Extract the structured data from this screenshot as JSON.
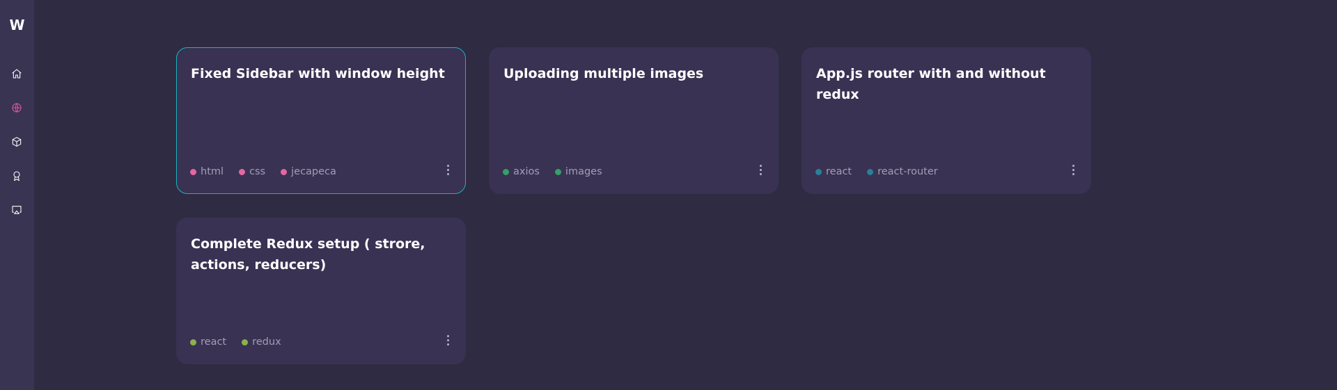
{
  "app": {
    "logo": "W"
  },
  "sidebar": {
    "icons": [
      "home-icon",
      "globe-icon",
      "cube-icon",
      "award-icon",
      "airplay-icon"
    ],
    "active": "globe-icon"
  },
  "colors": {
    "selected_border": "#1bb3be",
    "pink": "#e5679f",
    "green": "#35a067",
    "teal": "#2a7f9b",
    "olive": "#8bb24d"
  },
  "cards": [
    {
      "title": "Fixed Sidebar with window height",
      "selected": true,
      "tags": [
        {
          "label": "html",
          "color": "#e5679f"
        },
        {
          "label": "css",
          "color": "#e5679f"
        },
        {
          "label": "jecapeca",
          "color": "#e5679f"
        }
      ]
    },
    {
      "title": "Uploading multiple images",
      "selected": false,
      "tags": [
        {
          "label": "axios",
          "color": "#35a067"
        },
        {
          "label": "images",
          "color": "#35a067"
        }
      ]
    },
    {
      "title": "App.js router with and without redux",
      "selected": false,
      "tags": [
        {
          "label": "react",
          "color": "#2a7f9b"
        },
        {
          "label": "react-router",
          "color": "#2a7f9b"
        }
      ]
    },
    {
      "title": "Complete Redux setup ( strore, actions, reducers)",
      "selected": false,
      "tags": [
        {
          "label": "react",
          "color": "#8bb24d"
        },
        {
          "label": "redux",
          "color": "#8bb24d"
        }
      ]
    }
  ]
}
